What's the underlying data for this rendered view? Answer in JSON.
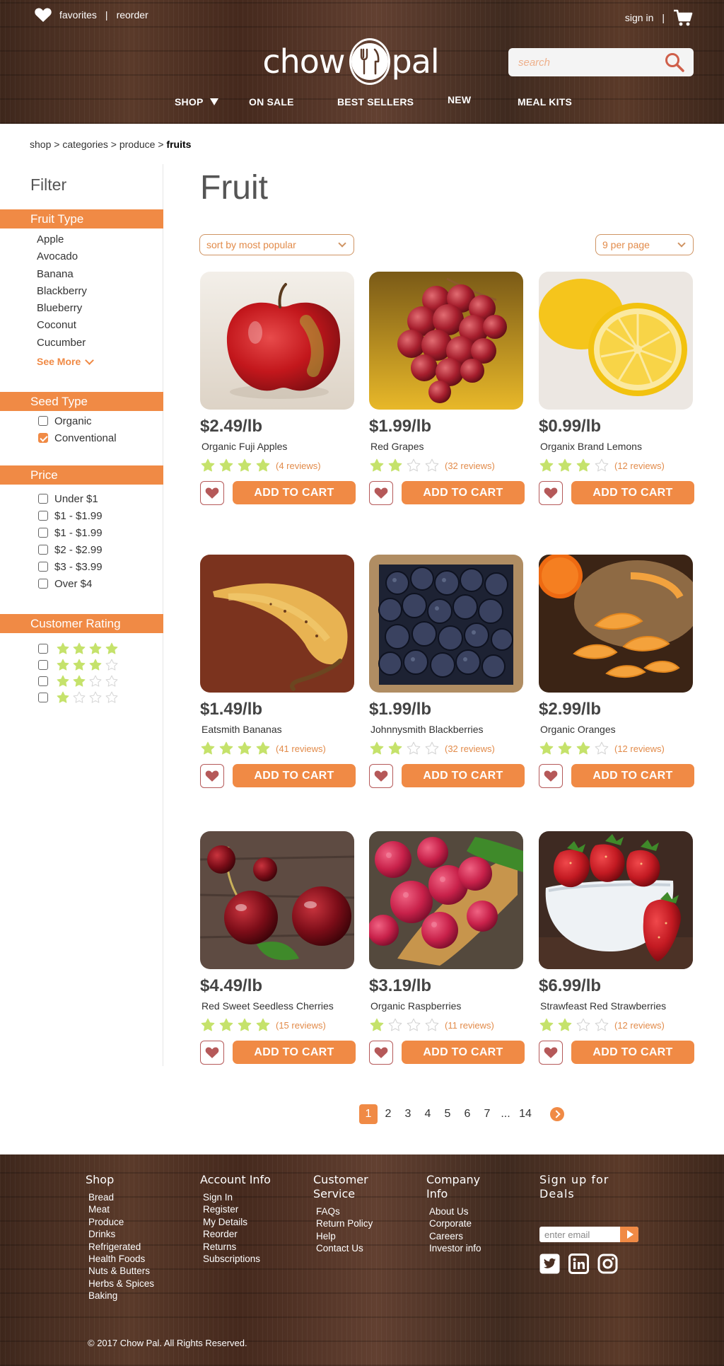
{
  "header": {
    "favorites": "favorites",
    "reorder": "reorder",
    "sign_in": "sign in",
    "logo_left": "chow",
    "logo_right": "pal",
    "search_placeholder": "search",
    "nav": [
      {
        "label": "SHOP"
      },
      {
        "label": "ON SALE"
      },
      {
        "label": "BEST SELLERS"
      },
      {
        "label": "NEW"
      },
      {
        "label": "MEAL KITS"
      }
    ]
  },
  "breadcrumb": {
    "path": "shop > categories > produce > ",
    "current": "fruits"
  },
  "sidebar": {
    "title": "Filter",
    "fruit_type": {
      "heading": "Fruit Type",
      "items": [
        "Apple",
        "Avocado",
        "Banana",
        "Blackberry",
        "Blueberry",
        "Coconut",
        "Cucumber"
      ],
      "see_more": "See More"
    },
    "seed_type": {
      "heading": "Seed Type",
      "options": [
        {
          "label": "Organic",
          "checked": false
        },
        {
          "label": "Conventional",
          "checked": true
        }
      ]
    },
    "price": {
      "heading": "Price",
      "options": [
        "Under $1",
        "$1 - $1.99",
        "$1 - $1.99",
        "$2 - $2.99",
        "$3 - $3.99",
        "Over $4"
      ]
    },
    "rating": {
      "heading": "Customer Rating",
      "options": [
        4,
        3,
        2,
        1
      ]
    }
  },
  "main": {
    "title": "Fruit",
    "sort_value": "sort by most popular",
    "per_page_value": "9 per page",
    "add_to_cart_label": "ADD TO CART",
    "products": [
      {
        "price": "$2.49/lb",
        "name": "Organic Fuji Apples",
        "rating": 4,
        "reviews": "(4 reviews)",
        "image": "apple"
      },
      {
        "price": "$1.99/lb",
        "name": "Red Grapes",
        "rating": 2,
        "reviews": "(32 reviews)",
        "image": "grapes"
      },
      {
        "price": "$0.99/lb",
        "name": "Organix Brand Lemons",
        "rating": 3,
        "reviews": "(12 reviews)",
        "image": "lemon"
      },
      {
        "price": "$1.49/lb",
        "name": "Eatsmith Bananas",
        "rating": 4,
        "reviews": "(41 reviews)",
        "image": "banana"
      },
      {
        "price": "$1.99/lb",
        "name": "Johnnysmith Blackberries",
        "rating": 2,
        "reviews": "(32 reviews)",
        "image": "blackberries"
      },
      {
        "price": "$2.99/lb",
        "name": "Organic Oranges",
        "rating": 3,
        "reviews": "(12 reviews)",
        "image": "oranges"
      },
      {
        "price": "$4.49/lb",
        "name": "Red Sweet Seedless Cherries",
        "rating": 4,
        "reviews": "(15 reviews)",
        "image": "cherries"
      },
      {
        "price": "$3.19/lb",
        "name": "Organic Raspberries",
        "rating": 1,
        "reviews": "(11 reviews)",
        "image": "raspberries"
      },
      {
        "price": "$6.99/lb",
        "name": "Strawfeast Red Strawberries",
        "rating": 2,
        "reviews": "(12 reviews)",
        "image": "strawberries"
      }
    ]
  },
  "pagination": {
    "pages": [
      "1",
      "2",
      "3",
      "4",
      "5",
      "6",
      "7"
    ],
    "ellipsis": "...",
    "last": "14",
    "current": "1"
  },
  "footer": {
    "columns": [
      {
        "title": "Shop",
        "items": [
          "Bread",
          "Meat",
          "Produce",
          "Drinks",
          "Refrigerated",
          "Health Foods",
          "Nuts & Butters",
          "Herbs & Spices",
          "Baking"
        ]
      },
      {
        "title": "Account Info",
        "items": [
          "Sign In",
          "Register",
          "My Details",
          "Reorder",
          "Returns",
          "Subscriptions"
        ]
      },
      {
        "title": "Customer Service",
        "items": [
          "FAQs",
          "Return Policy",
          "Help",
          "Contact Us"
        ]
      },
      {
        "title": "Company Info",
        "items": [
          "About Us",
          "Corporate",
          "Careers",
          "Investor info"
        ]
      }
    ],
    "signup_title": "Sign up for Deals",
    "signup_placeholder": "enter email",
    "social_icons": [
      "twitter-icon",
      "linkedin-icon",
      "instagram-icon"
    ],
    "copyright": "© 2017 Chow Pal.  All Rights Reserved."
  },
  "colors": {
    "accent": "#f08a45",
    "star": "#c5e26b",
    "heart": "#b55959"
  }
}
